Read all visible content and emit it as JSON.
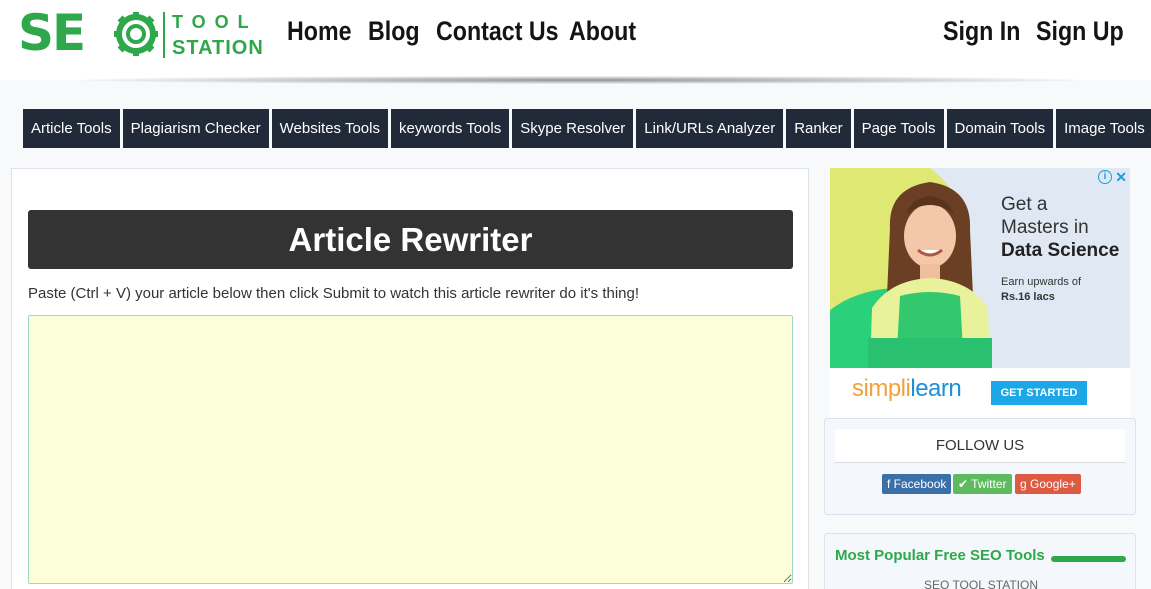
{
  "logo": {
    "seo": "SEO",
    "tool": "TOOL",
    "station": "STATION"
  },
  "nav": {
    "home": "Home",
    "blog": "Blog",
    "contact": "Contact Us",
    "about": "About",
    "signin": "Sign In",
    "signup": "Sign Up"
  },
  "menu": [
    "Article Tools",
    "Plagiarism Checker",
    "Websites Tools",
    "keywords Tools",
    "Skype Resolver",
    "Link/URLs Analyzer",
    "Ranker",
    "Page Tools",
    "Domain Tools",
    "Image Tools"
  ],
  "main": {
    "title": "Article Rewriter",
    "instructions": "Paste (Ctrl + V) your article below then click Submit to watch this article rewriter do it's thing!",
    "article_value": ""
  },
  "ad": {
    "info_icon": "info-icon",
    "close_icon": "close-icon",
    "headline1": "Get a",
    "headline2": "Masters in",
    "headline3": "Data Science",
    "sub1": "Earn upwards of",
    "sub2": "Rs.16 lacs",
    "brand_simpli": "simpl",
    "brand_i": "i",
    "brand_learn": "learn",
    "cta": "GET STARTED"
  },
  "follow": {
    "title": "FOLLOW US",
    "facebook": "Facebook",
    "twitter": "Twitter",
    "googleplus": "Google+"
  },
  "popular": {
    "title": "Most Popular Free SEO Tools",
    "sub": "SEO TOOL STATION"
  },
  "colors": {
    "brand_green": "#2ea84a",
    "menu_bg": "#212a38",
    "title_bar": "#333333",
    "input_bg": "#fbfed9"
  }
}
